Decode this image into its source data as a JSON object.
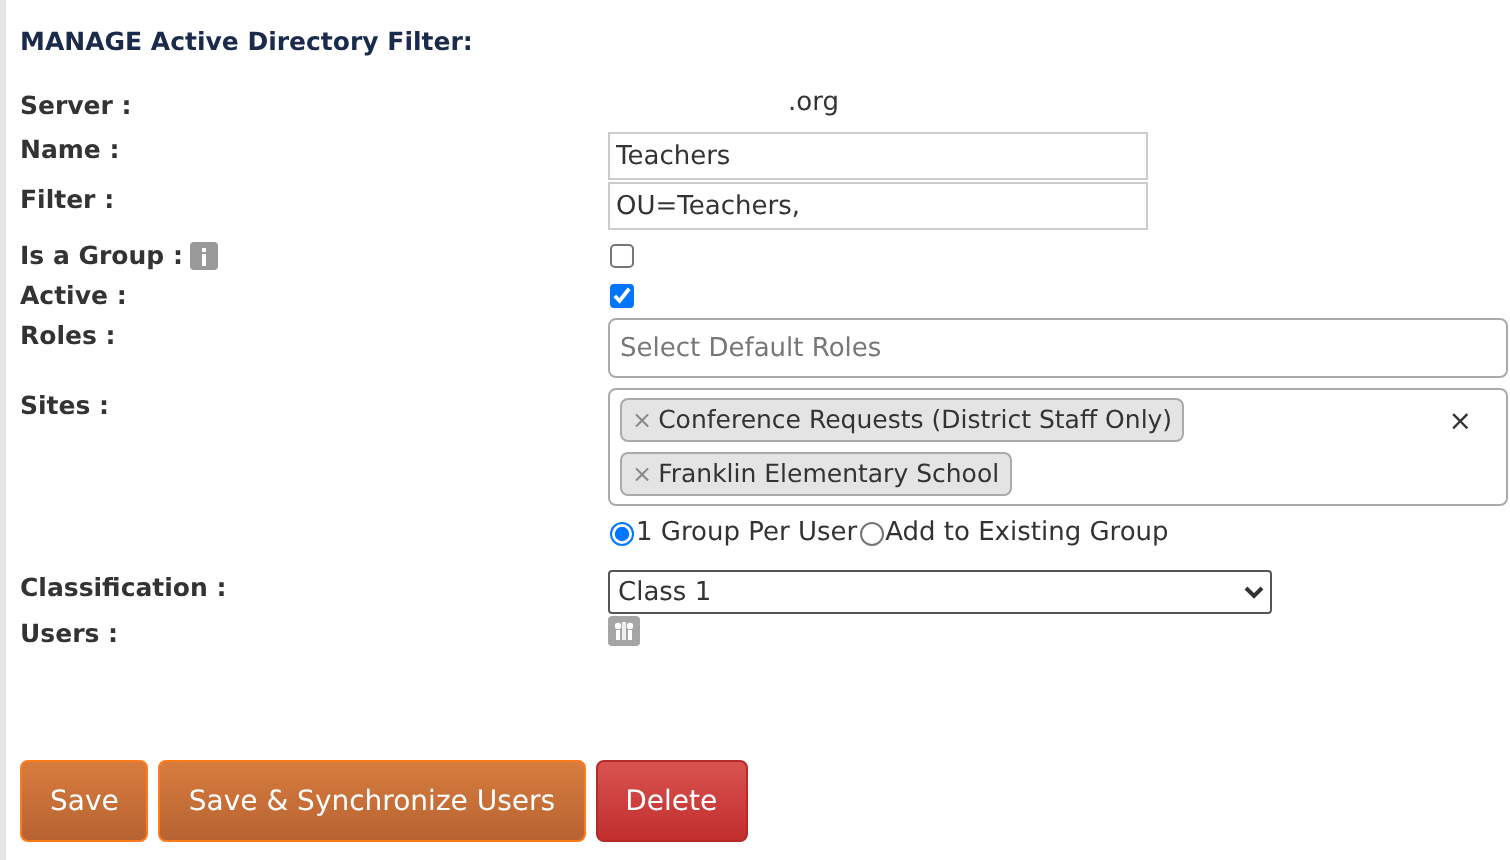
{
  "title": "MANAGE Active Directory Filter:",
  "server": {
    "label": "Server :",
    "value": ".org"
  },
  "name": {
    "label": "Name :",
    "value": "Teachers"
  },
  "filter": {
    "label": "Filter :",
    "value": "OU=Teachers,"
  },
  "is_group": {
    "label": "Is a Group :",
    "checked": false
  },
  "active": {
    "label": "Active :",
    "checked": true
  },
  "roles": {
    "label": "Roles :",
    "placeholder": "Select Default Roles"
  },
  "sites": {
    "label": "Sites :",
    "clear": "×",
    "tags": [
      {
        "remove": "×",
        "text": "Conference Requests (District Staff Only)"
      },
      {
        "remove": "×",
        "text": "Franklin Elementary School"
      }
    ]
  },
  "group_mode": [
    {
      "label": "1 Group Per User",
      "selected": true
    },
    {
      "label": "Add to Existing Group",
      "selected": false
    }
  ],
  "classification": {
    "label": "Classification :",
    "value": "Class 1"
  },
  "users": {
    "label": "Users :"
  },
  "buttons": [
    {
      "kind": "primary",
      "label": "Save"
    },
    {
      "kind": "primary",
      "label": "Save & Synchronize Users"
    },
    {
      "kind": "danger",
      "label": "Delete"
    }
  ]
}
